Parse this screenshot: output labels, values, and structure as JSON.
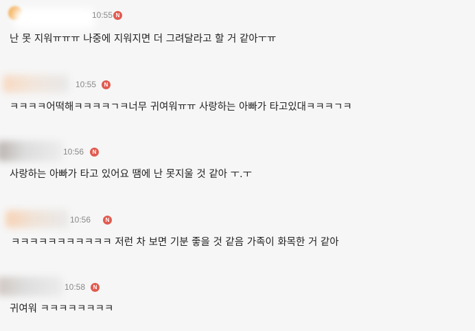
{
  "comments": [
    {
      "time": "10:55",
      "badge": "N",
      "text": "난 못 지워ㅠㅠㅠ 나중에 지워지면 더 그려달라고 할 거 같아ㅜㅠ"
    },
    {
      "time": "10:55",
      "badge": "N",
      "text": "ㅋㅋㅋㅋ어떡해ㅋㅋㅋㅋㄱㅋ너무 귀여워ㅠㅠ 사랑하는 아빠가 타고있대ㅋㅋㅋㄱㅋ"
    },
    {
      "time": "10:56",
      "badge": "N",
      "text": "사랑하는 아빠가 타고 있어요 땜에 난 못지울 것 같아 ㅜ.ㅜ"
    },
    {
      "time": "10:56",
      "badge": "N",
      "text": "ㅋㅋㅋㅋㅋㅋㅋㅋㅋㅋㅋ 저런 차 보면 기분 좋을 것 같음 가족이 화목한 거 같아"
    },
    {
      "time": "10:58",
      "badge": "N",
      "text": "귀여워 ㅋㅋㅋㅋㅋㅋㅋㅋ"
    }
  ],
  "colors": {
    "background": "#f6f6f6",
    "badge": "#e15b50",
    "time": "#888888",
    "text": "#222222"
  }
}
